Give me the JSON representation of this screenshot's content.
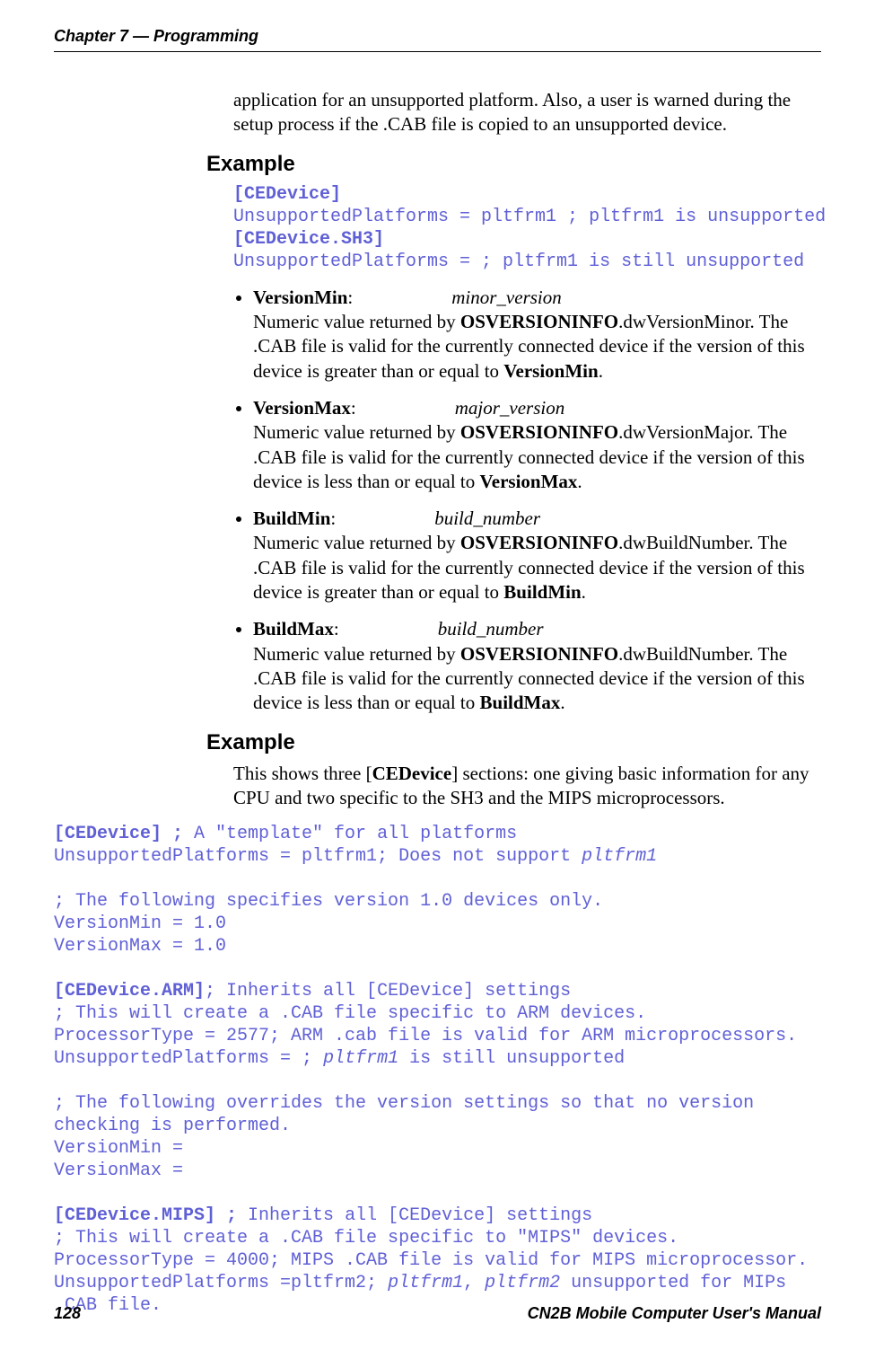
{
  "header": {
    "chapter": "Chapter 7 — Programming"
  },
  "intro": "application for an unsupported platform. Also, a user is warned during the setup process if the .CAB file is copied to an unsupported device.",
  "example1_heading": "Example",
  "code1": {
    "l1_bold": "[CEDevice]",
    "l2": "UnsupportedPlatforms = pltfrm1 ; pltfrm1 is unsupported",
    "l3_bold": "[CEDevice.SH3]",
    "l4": "UnsupportedPlatforms = ; pltfrm1 is still unsupported"
  },
  "bullets": [
    {
      "term": "VersionMin",
      "param": "minor_version",
      "pre": "Numeric value returned by ",
      "api": "OSVERSIONINFO",
      "post1": ".dwVersionMinor. The .CAB file is valid for the currently connected device if the version of this device is greater than or equal to ",
      "boldend": "VersionMin",
      "dot": "."
    },
    {
      "term": "VersionMax",
      "param": "major_version",
      "pre": "Numeric value returned by ",
      "api": "OSVERSIONINFO",
      "post1": ".dwVersionMajor. The .CAB file is valid for the currently connected device if the version of this device is less than or equal to ",
      "boldend": "VersionMax",
      "dot": "."
    },
    {
      "term": "BuildMin",
      "param": "build_number",
      "pre": "Numeric value returned by ",
      "api": "OSVERSIONINFO",
      "post1": ".dwBuildNumber. The .CAB file is valid for the currently connected device if the version of this device is greater than or equal to ",
      "boldend": "BuildMin",
      "dot": "."
    },
    {
      "term": "BuildMax",
      "param": "build_number",
      "pre": "Numeric value returned by ",
      "api": "OSVERSIONINFO",
      "post1": ".dwBuildNumber. The .CAB file is valid for the currently connected device if the version of this device is less than or equal to ",
      "boldend": "BuildMax",
      "dot": "."
    }
  ],
  "example2_heading": "Example",
  "example2_para_pre": "This shows three [",
  "example2_bold": "CEDevice",
  "example2_para_post": "] sections: one giving basic information for any CPU and two specific to the SH3 and the MIPS microprocessors.",
  "code2": {
    "l1_b": "[CEDevice] ; ",
    "l1_r": "A \"template\" for all platforms",
    "l2_r": "UnsupportedPlatforms = pltfrm1; Does not support ",
    "l2_i": "pltfrm1",
    "l3": "",
    "l4": "; The following specifies version 1.0 devices only.",
    "l5": "VersionMin = 1.0",
    "l6": "VersionMax = 1.0",
    "l7": "",
    "l8_b": "[CEDevice.ARM]",
    "l8_r": "; Inherits all [CEDevice] settings",
    "l9": "; This will create a .CAB file specific to ARM devices.",
    "l10": "ProcessorType = 2577; ARM .cab file is valid for ARM microprocessors.",
    "l11_r": "UnsupportedPlatforms = ; ",
    "l11_i": "pltfrm1",
    "l11_r2": " is still unsupported",
    "l12": "",
    "l13": "; The following overrides the version settings so that no version checking is performed.",
    "l14": "VersionMin =",
    "l15": "VersionMax =",
    "l16": "",
    "l17_b": "[CEDevice.MIPS] ; ",
    "l17_r": "Inherits all [CEDevice] settings",
    "l18": "; This will create a .CAB file specific to \"MIPS\" devices.",
    "l19": "ProcessorType = 4000; MIPS .CAB file is valid for MIPS microprocessor.",
    "l20_r": "UnsupportedPlatforms =pltfrm2; ",
    "l20_i1": "pltfrm1",
    "l20_r2": ", ",
    "l20_i2": "pltfrm2",
    "l20_r3": " unsupported for MIPs .CAB file."
  },
  "footer": {
    "page": "128",
    "title": "CN2B Mobile Computer User's Manual"
  }
}
